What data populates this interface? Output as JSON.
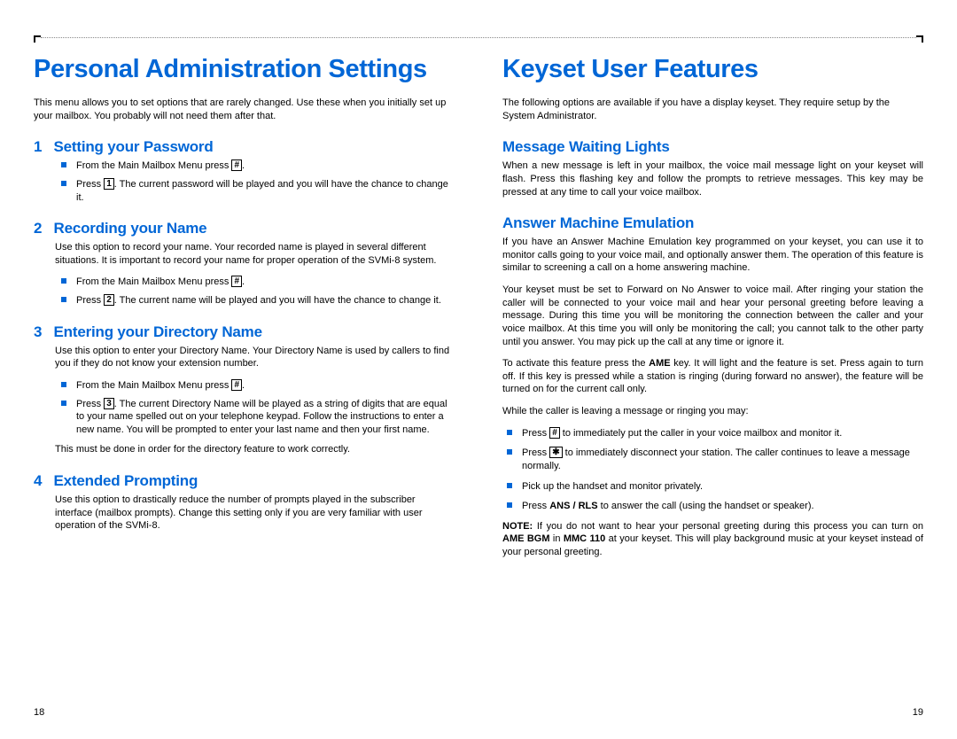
{
  "keys": {
    "hash": "#",
    "one": "1",
    "two": "2",
    "three": "3",
    "star": "✱"
  },
  "left": {
    "title": "Personal Administration Settings",
    "intro": "This menu allows you to set options that are rarely changed. Use these when you initially set up your mailbox. You probably will not need them after that.",
    "s1": {
      "num": "1",
      "title": "Setting your Password",
      "b1a": "From the Main Mailbox Menu press ",
      "b1c": ".",
      "b2a": "Press ",
      "b2c": ". The current password will be played and you will have the chance to change it."
    },
    "s2": {
      "num": "2",
      "title": "Recording your Name",
      "desc": "Use this option to record your name. Your recorded name is played in several different situations. It is important to record your name for proper operation of the SVMi-8 system.",
      "b1a": "From the Main Mailbox Menu press ",
      "b1c": ".",
      "b2a": "Press ",
      "b2c": ". The current name will be played and you will have the chance to change it."
    },
    "s3": {
      "num": "3",
      "title": "Entering your Directory Name",
      "desc": "Use this option to enter your Directory Name. Your Directory Name is used by callers to find you if they do not know your extension number.",
      "b1a": "From the Main Mailbox Menu press ",
      "b1c": ".",
      "b2a": "Press ",
      "b2c": ". The current Directory Name will be played as a string of digits that are equal to your name spelled out on your telephone keypad. Follow the instructions to enter a new name. You will be prompted to enter your last name and then your first name.",
      "after": "This must be done in order for the directory feature to work correctly."
    },
    "s4": {
      "num": "4",
      "title": "Extended Prompting",
      "desc": "Use this option to drastically reduce the number of prompts played in the subscriber interface (mailbox prompts). Change this setting only if you are very familiar with user operation of the SVMi-8."
    },
    "pagenum": "18"
  },
  "right": {
    "title": "Keyset User Features",
    "intro": "The following options are available if you have a display keyset. They require setup by the System Administrator.",
    "h1": "Message Waiting Lights",
    "p1": "When a new message is left in your mailbox, the voice mail message light on your keyset will flash. Press this flashing key and follow the prompts to retrieve messages. This key may be pressed at any time to call your voice mailbox.",
    "h2": "Answer Machine Emulation",
    "p2": "If you have an Answer Machine Emulation key programmed on your keyset, you can use it to monitor calls going to your voice mail, and optionally answer them. The operation of this feature is similar to screening a call on a home answering machine.",
    "p3": "Your keyset must be set to Forward on No Answer to voice mail. After ringing your station the caller will be connected to your voice mail and hear your personal greeting before leaving a message. During this time you will be monitoring the connection between the caller and your voice mailbox. At this time you will only be monitoring the call; you cannot talk to the other party until you answer. You may pick up the call at any time or ignore it.",
    "p4a": "To activate this feature press the ",
    "p4key": "AME",
    "p4b": " key. It will light and the feature is set. Press again to turn off. If this key is pressed while a station is ringing (during forward no answer), the feature will be turned on for the current call only.",
    "p5": "While the caller is leaving a message or ringing you may:",
    "b1a": "Press ",
    "b1c": " to immediately put the caller in your voice mailbox and monitor it.",
    "b2a": "Press ",
    "b2c": " to immediately disconnect your station. The caller continues to leave a message normally.",
    "b3": "Pick up the handset and monitor privately.",
    "b4a": "Press ",
    "b4key": "ANS / RLS",
    "b4c": " to answer the call (using the handset or speaker).",
    "noteLabel": "NOTE:",
    "noteA": " If you do not want to hear your personal greeting during this process you can turn on ",
    "noteKey1": "AME BGM",
    "noteB": " in ",
    "noteKey2": "MMC 110",
    "noteC": " at your keyset. This will play background music at your keyset instead of your personal greeting.",
    "pagenum": "19"
  }
}
